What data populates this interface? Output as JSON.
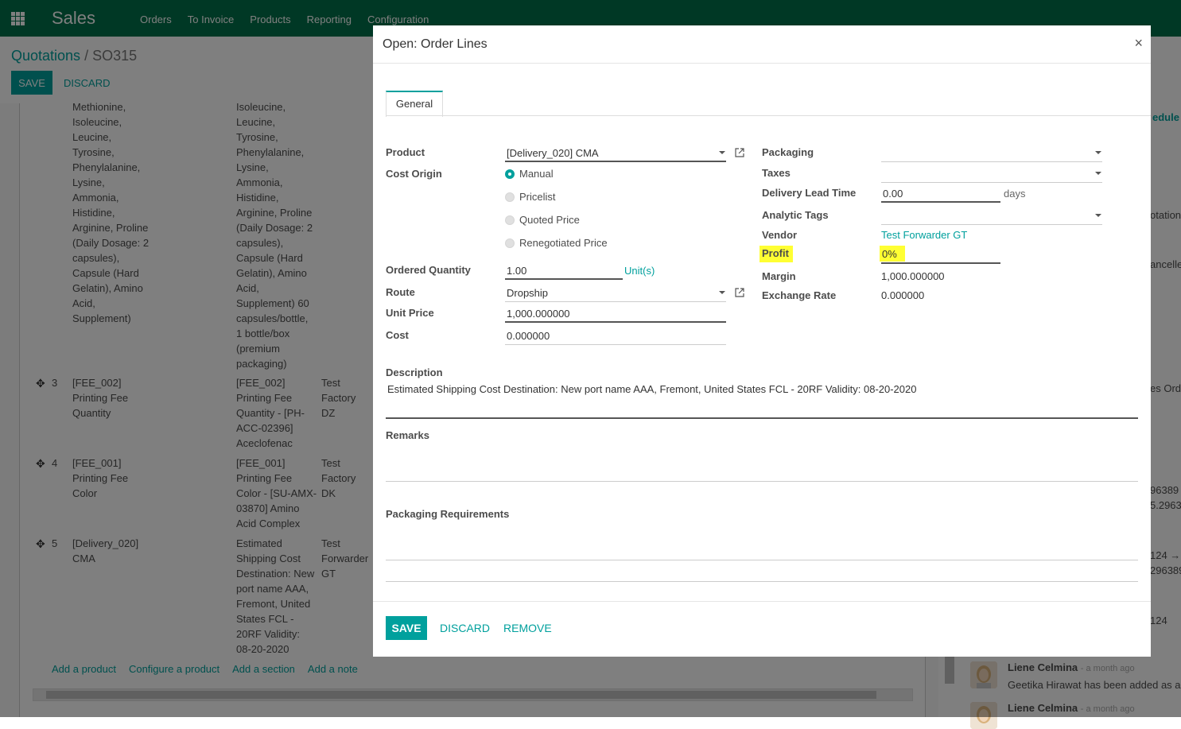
{
  "app": {
    "name": "Sales",
    "menu": [
      "Orders",
      "To Invoice",
      "Products",
      "Reporting",
      "Configuration"
    ]
  },
  "breadcrumb": {
    "parent": "Quotations",
    "separator": "/",
    "current": "SO315"
  },
  "control_buttons": {
    "save": "SAVE",
    "discard": "DISCARD"
  },
  "order_lines": {
    "row2_product_tail": "Methionine,\nIsoleucine,\nLeucine,\nTyrosine,\nPhenylalanine,\nLysine,\nAmmonia,\nHistidine,\nArginine, Proline\n(Daily Dosage: 2\ncapsules),\nCapsule (Hard\nGelatin), Amino\nAcid,\nSupplement)",
    "row2_description_tail": "Isoleucine,\nLeucine,\nTyrosine,\nPhenylalanine,\nLysine,\nAmmonia,\nHistidine,\nArginine, Proline\n(Daily Dosage: 2\ncapsules),\nCapsule (Hard\nGelatin), Amino\nAcid,\nSupplement) 60\ncapsules/bottle,\n1 bottle/box\n(premium\npackaging)",
    "rows": [
      {
        "no": "3",
        "product": "[FEE_002]\nPrinting Fee\nQuantity",
        "description": "[FEE_002]\nPrinting Fee\nQuantity - [PH-\nACC-02396]\nAceclofenac",
        "vendor": "Test\nFactory\nDZ"
      },
      {
        "no": "4",
        "product": "[FEE_001]\nPrinting Fee\nColor",
        "description": "[FEE_001]\nPrinting Fee\nColor - [SU-AMX-\n03870] Amino\nAcid Complex",
        "vendor": "Test\nFactory\nDK"
      },
      {
        "no": "5",
        "product": "[Delivery_020]\nCMA",
        "description": "Estimated\nShipping Cost\nDestination: New\nport name AAA,\nFremont, United\nStates FCL -\n20RF Validity:\n08-20-2020",
        "vendor": "Test\nForwarder\nGT"
      }
    ],
    "footer_links": [
      "Add a product",
      "Configure a product",
      "Add a section",
      "Add a note"
    ]
  },
  "right_clipped": {
    "schedule": "edule a",
    "quotation": "otation",
    "cancelled": "ancelle",
    "sales_order": "es Ord",
    "val1": "96389",
    "val2": "5.2963",
    "val3": "124 →",
    "val4": "296389",
    "val5": "124"
  },
  "chatter": {
    "messages": [
      {
        "author": "Liene Celmina",
        "when": "- a month ago",
        "body": "Geetika Hirawat has been added as a"
      },
      {
        "author": "Liene Celmina",
        "when": "- a month ago",
        "body": ""
      }
    ]
  },
  "modal": {
    "title": "Open: Order Lines",
    "close": "×",
    "tab": "General",
    "left": {
      "product_label": "Product",
      "product_value": "[Delivery_020] CMA",
      "cost_origin_label": "Cost Origin",
      "cost_origin_options": [
        "Manual",
        "Pricelist",
        "Quoted Price",
        "Renegotiated Price"
      ],
      "cost_origin_selected": "Manual",
      "ordered_qty_label": "Ordered Quantity",
      "ordered_qty_value": "1.00",
      "uom": "Unit(s)",
      "route_label": "Route",
      "route_value": "Dropship",
      "unit_price_label": "Unit Price",
      "unit_price_value": "1,000.000000",
      "cost_label": "Cost",
      "cost_value": "0.000000"
    },
    "right": {
      "packaging_label": "Packaging",
      "packaging_value": "",
      "taxes_label": "Taxes",
      "taxes_value": "",
      "lead_time_label": "Delivery Lead Time",
      "lead_time_value": "0.00",
      "lead_time_unit": "days",
      "analytic_tags_label": "Analytic Tags",
      "analytic_tags_value": "",
      "vendor_label": "Vendor",
      "vendor_value": "Test Forwarder GT",
      "profit_label": "Profit",
      "profit_value": "0%",
      "margin_label": "Margin",
      "margin_value": "1,000.000000",
      "exchange_rate_label": "Exchange Rate",
      "exchange_rate_value": "0.000000"
    },
    "description_label": "Description",
    "description_value": "Estimated Shipping Cost Destination: New port name AAA, Fremont, United States FCL - 20RF Validity: 08-20-2020",
    "remarks_label": "Remarks",
    "remarks_value": "",
    "packaging_req_label": "Packaging Requirements",
    "packaging_req_value": "",
    "footer": {
      "save": "SAVE",
      "discard": "DISCARD",
      "remove": "REMOVE"
    }
  },
  "colors": {
    "brand": "#00704a",
    "accent": "#00a09d",
    "highlight": "#ffff33"
  }
}
